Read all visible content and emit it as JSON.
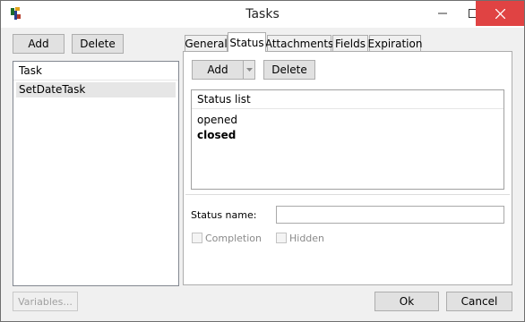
{
  "window": {
    "title": "Tasks"
  },
  "toolbar": {
    "add_label": "Add",
    "delete_label": "Delete"
  },
  "task_list": {
    "header": "Task",
    "items": [
      "SetDateTask"
    ]
  },
  "tabs": [
    "General",
    "Status",
    "Attachments",
    "Fields",
    "Expiration"
  ],
  "status_tab": {
    "add_label": "Add",
    "delete_label": "Delete",
    "list_header": "Status list",
    "items": [
      "opened",
      "closed"
    ],
    "status_name_label": "Status name:",
    "status_name_value": "",
    "completion_label": "Completion",
    "hidden_label": "Hidden"
  },
  "footer": {
    "variables_label": "Variables...",
    "ok_label": "Ok",
    "cancel_label": "Cancel"
  },
  "colors": {
    "close_button": "#e04343",
    "selected_row": "#e6e6e6"
  }
}
